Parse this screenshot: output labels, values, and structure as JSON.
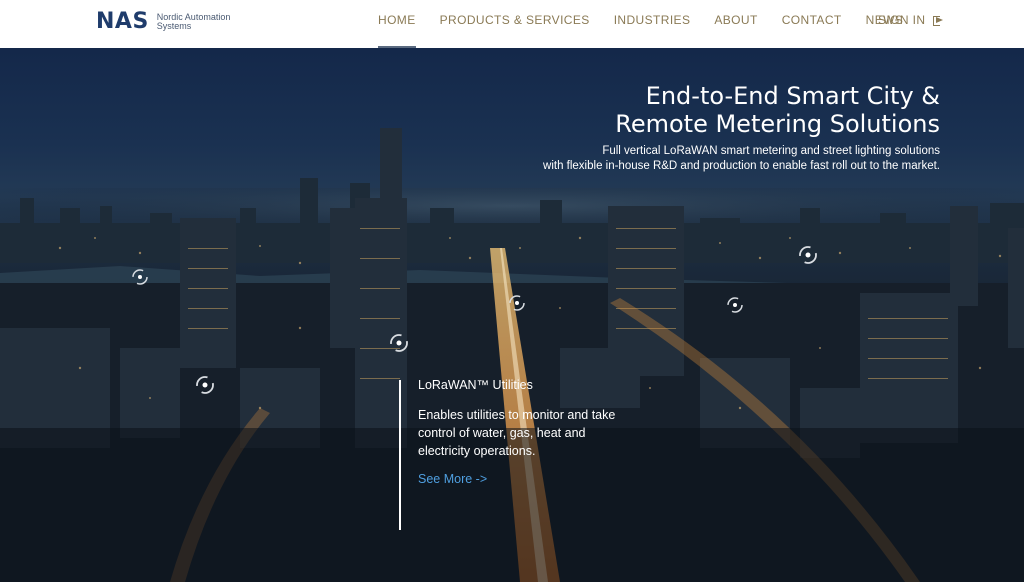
{
  "brand": {
    "logo": "NAS",
    "name_line1": "Nordic Automation",
    "name_line2": "Systems"
  },
  "nav": {
    "items": [
      {
        "label": "HOME",
        "active": true
      },
      {
        "label": "PRODUCTS & SERVICES",
        "active": false
      },
      {
        "label": "INDUSTRIES",
        "active": false
      },
      {
        "label": "ABOUT",
        "active": false
      },
      {
        "label": "CONTACT",
        "active": false
      },
      {
        "label": "NEWS",
        "active": false
      }
    ],
    "signin_label": "SIGN IN",
    "signin_icon": "sign-in-icon"
  },
  "hero": {
    "title_line1": "End-to-End Smart City &",
    "title_line2": "Remote Metering Solutions",
    "subtitle_line1": "Full vertical LoRaWAN smart metering and street lighting solutions",
    "subtitle_line2": "with flexible in-house R&D and production to enable fast roll out to the market.",
    "feature": {
      "title": "LoRaWAN™ Utilities",
      "text": "Enables utilities to monitor and take control of water, gas, heat and electricity operations.",
      "link": "See More ->"
    },
    "hotspot_icon": "hotspot-icon"
  },
  "colors": {
    "nav_text": "#8a7a55",
    "logo": "#1f3c6b",
    "link": "#4f9fe0",
    "header_bg": "#ffffff"
  }
}
